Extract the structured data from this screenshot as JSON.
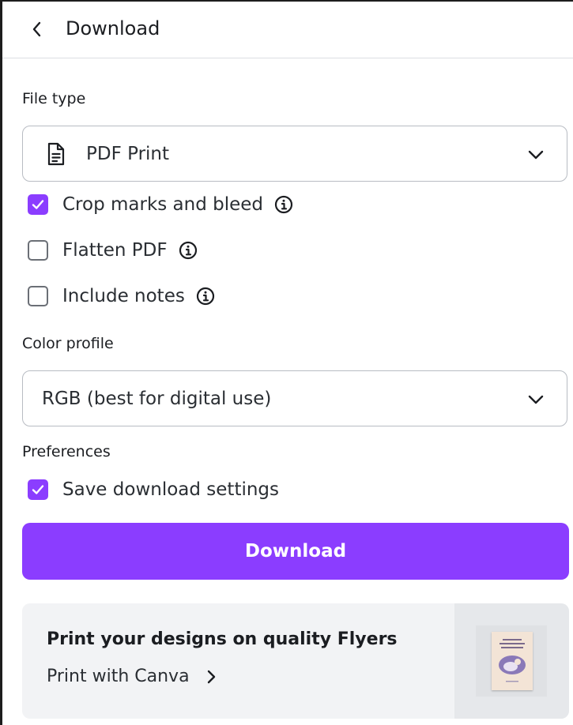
{
  "header": {
    "title": "Download",
    "back_icon": "chevron-left-icon"
  },
  "file_type": {
    "label": "File type",
    "selected": "PDF Print",
    "icon": "document-icon"
  },
  "options": [
    {
      "label": "Crop marks and bleed",
      "checked": true
    },
    {
      "label": "Flatten PDF",
      "checked": false
    },
    {
      "label": "Include notes",
      "checked": false
    }
  ],
  "color_profile": {
    "label": "Color profile",
    "selected": "RGB (best for digital use)"
  },
  "preferences": {
    "label": "Preferences",
    "save_settings": {
      "label": "Save download settings",
      "checked": true
    }
  },
  "download_button": {
    "label": "Download"
  },
  "promo": {
    "title": "Print your designs on quality Flyers",
    "link": "Print with Canva"
  },
  "colors": {
    "accent": "#8b3dff",
    "promo_bg": "#f2f3f5"
  }
}
